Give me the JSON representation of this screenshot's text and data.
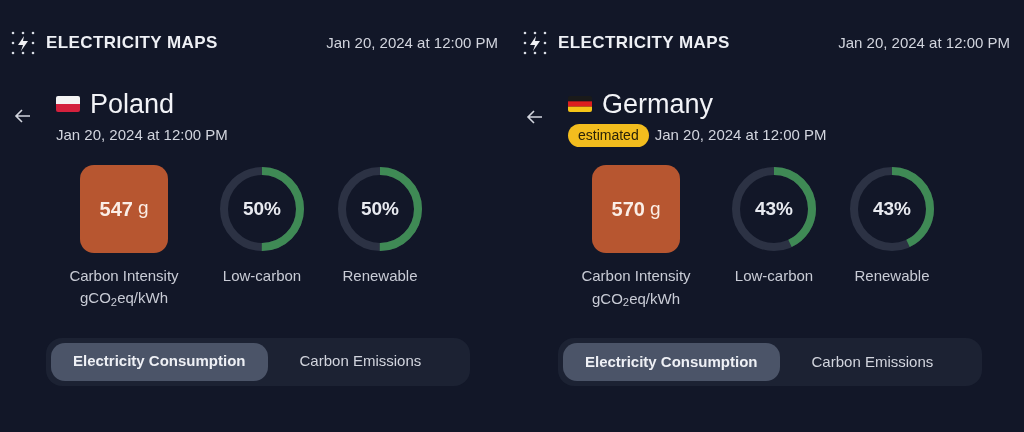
{
  "panels": [
    {
      "brand": "ELECTRICITY MAPS",
      "header_time": "Jan 20, 2024 at 12:00 PM",
      "country": "Poland",
      "flag": {
        "kind": "poland"
      },
      "time": "Jan 20, 2024 at 12:00 PM",
      "intensity": {
        "value": "547",
        "unit": "g",
        "label": "Carbon Intensity",
        "unit_label": "gCO$_{2}$eq/kWh"
      },
      "rings": [
        {
          "reading": "50%",
          "label": "Low-carbon"
        },
        {
          "reading": "50%",
          "label": "Renewable"
        }
      ],
      "tabs": [
        {
          "label": "Electricity Consumption",
          "selected": true
        },
        {
          "label": "Carbon Emissions",
          "selected": false
        }
      ]
    },
    {
      "brand": "ELECTRICITY MAPS",
      "header_time": "Jan 20, 2024 at 12:00 PM",
      "country": "Germany",
      "flag": {
        "kind": "germany"
      },
      "badge": "estimated",
      "time": "Jan 20, 2024 at 12:00 PM",
      "intensity": {
        "value": "570",
        "unit": "g",
        "label": "Carbon Intensity",
        "unit_label": "gCO$_{2}$eq/kWh"
      },
      "rings": [
        {
          "reading": "43%",
          "label": "Low-carbon"
        },
        {
          "reading": "43%",
          "label": "Renewable"
        }
      ],
      "tabs": [
        {
          "label": "Electricity Consumption",
          "selected": true
        },
        {
          "label": "Carbon Emissions",
          "selected": false
        }
      ]
    }
  ]
}
